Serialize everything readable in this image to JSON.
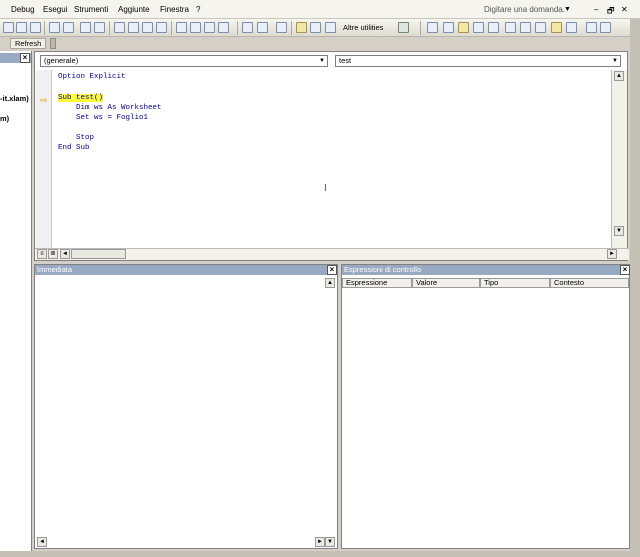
{
  "menu": {
    "items": [
      "Debug",
      "Esegui",
      "Strumenti",
      "Aggiunte",
      "Finestra",
      "?"
    ],
    "help_placeholder": "Digitare una domanda.",
    "win_min": "–",
    "win_max": "🗗",
    "win_close": "✕"
  },
  "toolbar": {
    "altre_label": "Altre utilities",
    "refresh_label": "Refresh"
  },
  "project": {
    "close": "×",
    "line1": "-it.xlam)",
    "line2": "m)"
  },
  "code": {
    "object_combo": "(generale)",
    "proc_combo": "test",
    "lines": [
      "Option Explicit",
      "",
      "Sub test()",
      "    Dim ws As Worksheet",
      "    Set ws = Foglio1",
      "",
      "    Stop",
      "End Sub"
    ]
  },
  "immediate": {
    "title": "Immediata",
    "close": "×"
  },
  "watch": {
    "title": "Espressioni di controllo",
    "close": "×",
    "columns": [
      "Espressione",
      "Valore",
      "Tipo",
      "Contesto"
    ]
  },
  "colors": {
    "pane_header": "#9aa9c2",
    "highlight": "#ffff3a",
    "code_text": "#00008b"
  }
}
